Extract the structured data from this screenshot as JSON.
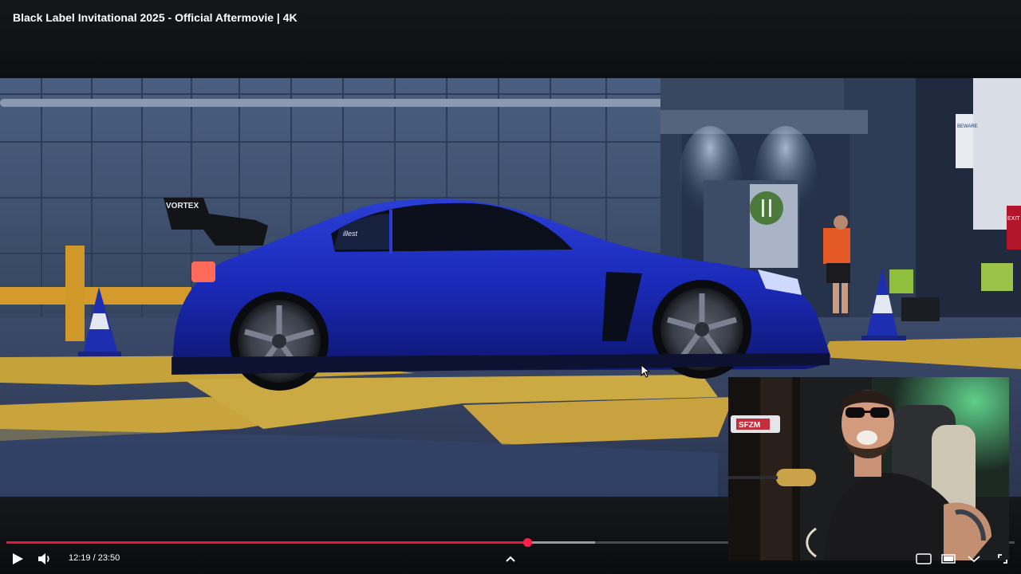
{
  "video": {
    "title": "Black Label Invitational 2025 - Official Aftermovie | 4K"
  },
  "player": {
    "current_time": "12:19",
    "duration": "23:50",
    "time_display": "12:19 / 23:50",
    "progress_fraction": 0.517,
    "buffered_fraction": 0.584,
    "colors": {
      "progress": "#e8173b",
      "buffer": "#9a9a9a",
      "track": "#4a4a4a"
    },
    "icons": {
      "play": "play-icon",
      "volume": "volume-icon",
      "expand": "chevron-up-icon",
      "miniplayer": "miniplayer-icon",
      "theater": "theater-icon",
      "cast": "cast-icon",
      "fullscreen": "fullscreen-icon"
    }
  },
  "scene": {
    "car_badge": "VORTEX",
    "window_sticker": "illest",
    "signs": [
      "BEWARE",
      "EXIT"
    ]
  },
  "webcam": {
    "mic_brand": "SFZM"
  }
}
